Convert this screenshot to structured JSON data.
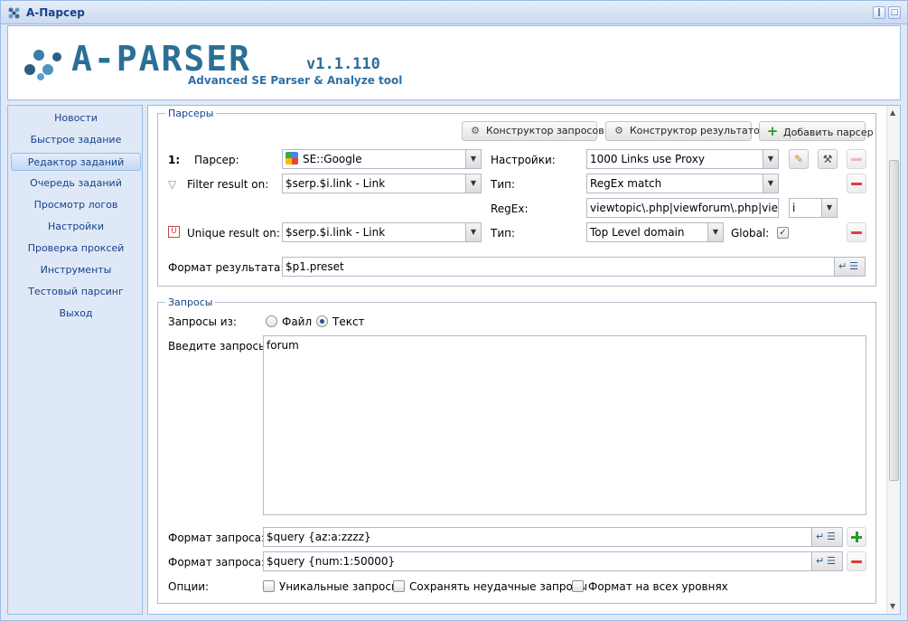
{
  "window": {
    "title": "A-Парсер"
  },
  "header": {
    "logo_text": "A-PARSER",
    "version": "v1.1.110",
    "subtitle": "Advanced SE Parser & Analyze tool"
  },
  "sidebar": {
    "items": [
      {
        "label": "Новости"
      },
      {
        "label": "Быстрое задание"
      },
      {
        "label": "Редактор заданий"
      },
      {
        "label": "Очередь заданий"
      },
      {
        "label": "Просмотр логов"
      },
      {
        "label": "Настройки"
      },
      {
        "label": "Проверка проксей"
      },
      {
        "label": "Инструменты"
      },
      {
        "label": "Тестовый парсинг"
      },
      {
        "label": "Выход"
      }
    ],
    "active_index": 2
  },
  "parsers": {
    "legend": "Парсеры",
    "btn_query_builder": "Конструктор запросов",
    "btn_result_builder": "Конструктор результатов",
    "btn_add_parser": "Добавить парсер",
    "index": "1:",
    "parser_label": "Парсер:",
    "parser_value": "SE::Google",
    "settings_label": "Настройки:",
    "settings_value": "1000 Links use Proxy",
    "filter_label": "Filter result on:",
    "filter_value": "$serp.$i.link - Link",
    "type_label": "Тип:",
    "filter_type_value": "RegEx match",
    "regex_label": "RegEx:",
    "regex_value": "viewtopic\\.php|viewforum\\.php|viewth",
    "regex_flag": "i",
    "unique_label": "Unique result on:",
    "unique_value": "$serp.$i.link - Link",
    "unique_type_value": "Top Level domain",
    "global_label": "Global:",
    "global_checked": true,
    "result_format_label": "Формат результата:",
    "result_format_value": "$p1.preset"
  },
  "queries": {
    "legend": "Запросы",
    "from_label": "Запросы из:",
    "option_file": "Файл",
    "option_text": "Текст",
    "selected": "Текст",
    "enter_label": "Введите запросы:",
    "queries_text": "forum",
    "format1_label": "Формат запроса:",
    "format1_value": "$query {az:a:zzzz}",
    "format2_label": "Формат запроса:",
    "format2_value": "$query {num:1:50000}",
    "options_label": "Опции:",
    "opt_unique": "Уникальные запросы",
    "opt_save_failed": "Сохранять неудачные запросы",
    "opt_format_all": "Формат на всех уровнях"
  },
  "colors": {
    "accent": "#15428b",
    "panel_bg": "#dfe8f6",
    "border": "#99bbe8",
    "logo": "#2b6f95"
  }
}
